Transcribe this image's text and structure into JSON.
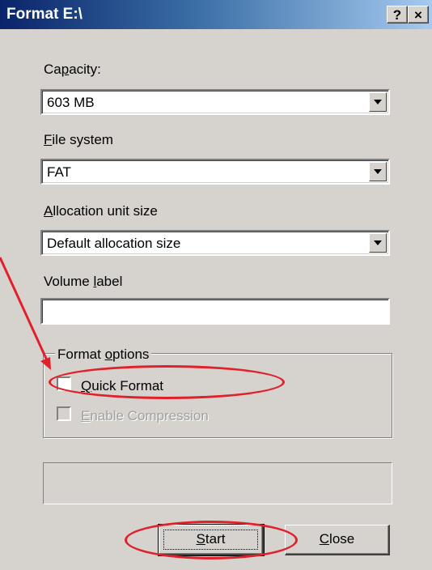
{
  "window": {
    "title": "Format E:\\",
    "help_button": "?",
    "close_button": "×"
  },
  "capacity": {
    "label": "Capacity:",
    "value": "603 MB"
  },
  "file_system": {
    "label": "File system",
    "value": "FAT"
  },
  "allocation": {
    "label": "Allocation unit size",
    "value": "Default allocation size"
  },
  "volume": {
    "label": "Volume label",
    "value": ""
  },
  "format_options": {
    "title": "Format options",
    "quick_format": {
      "label": "Quick Format",
      "checked": false,
      "enabled": true
    },
    "enable_compression": {
      "label": "Enable Compression",
      "checked": false,
      "enabled": false
    }
  },
  "buttons": {
    "start": "Start",
    "close": "Close"
  },
  "annotations": {
    "color": "#e0212b"
  }
}
